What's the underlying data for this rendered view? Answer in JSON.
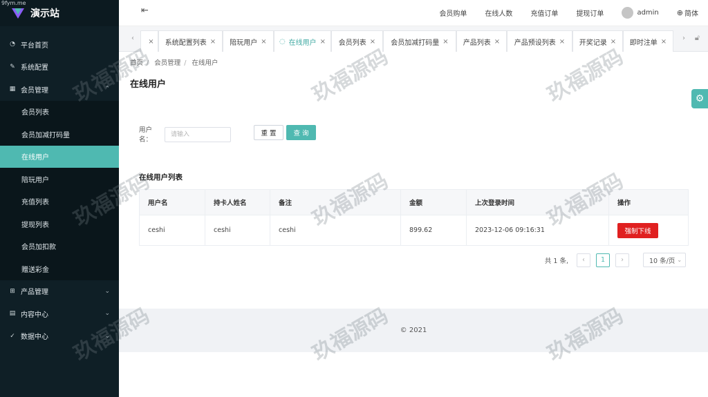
{
  "watermark_top": "9fym.me",
  "logo": {
    "text": "演示站"
  },
  "sidebar": {
    "items": [
      {
        "label": "平台首页",
        "icon": "dashboard-icon"
      },
      {
        "label": "系统配置",
        "icon": "edit-icon"
      },
      {
        "label": "会员管理",
        "icon": "table-icon",
        "expanded": true
      },
      {
        "label": "会员列表"
      },
      {
        "label": "会员加减打码量"
      },
      {
        "label": "在线用户",
        "active": true
      },
      {
        "label": "陪玩用户"
      },
      {
        "label": "充值列表"
      },
      {
        "label": "提现列表"
      },
      {
        "label": "会员加扣款"
      },
      {
        "label": "赠送彩金"
      },
      {
        "label": "产品管理",
        "icon": "grid-icon"
      },
      {
        "label": "内容中心",
        "icon": "document-icon"
      },
      {
        "label": "数据中心",
        "icon": "check-circle-icon"
      }
    ]
  },
  "header": {
    "links": [
      "会员购单",
      "在线人数",
      "充值订单",
      "提现订单"
    ],
    "user": "admin",
    "language": "简体"
  },
  "tabs": [
    {
      "label": "系统配置列表"
    },
    {
      "label": "陪玩用户"
    },
    {
      "label": "在线用户",
      "active": true
    },
    {
      "label": "会员列表"
    },
    {
      "label": "会员加减打码量"
    },
    {
      "label": "产品列表"
    },
    {
      "label": "产品预设列表"
    },
    {
      "label": "开奖记录"
    },
    {
      "label": "即时注单"
    }
  ],
  "breadcrumb": [
    "首页",
    "会员管理",
    "在线用户"
  ],
  "page_title": "在线用户",
  "search": {
    "label": "用户名：",
    "placeholder": "请输入",
    "reset": "重 置",
    "query": "查 询"
  },
  "table": {
    "title": "在线用户列表",
    "columns": [
      "用户名",
      "持卡人姓名",
      "备注",
      "金额",
      "上次登录时间",
      "操作"
    ],
    "rows": [
      {
        "username": "ceshi",
        "cardholder": "ceshi",
        "note": "ceshi",
        "amount": "899.62",
        "last_login": "2023-12-06 09:16:31",
        "action": "强制下线"
      }
    ]
  },
  "pagination": {
    "total": "共 1 条,",
    "current": "1",
    "page_size": "10 条/页"
  },
  "footer": {
    "text": "© 2021"
  },
  "watermark": "玖福源码",
  "colors": {
    "accent": "#4fb9b1",
    "sidebar": "#0f1f26",
    "danger": "#e02020"
  }
}
